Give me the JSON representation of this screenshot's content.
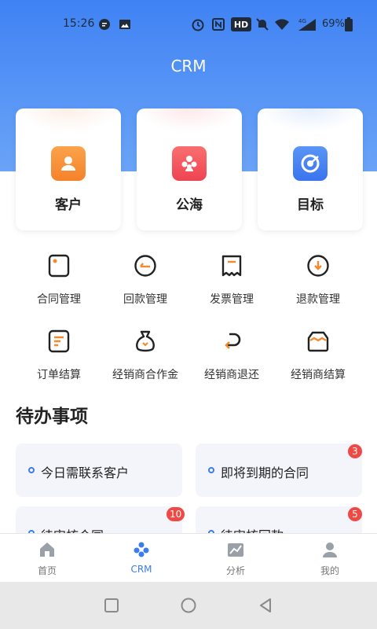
{
  "status_bar": {
    "time": "15:26",
    "network": "4G",
    "hd": "HD",
    "battery": "69%",
    "icons": [
      "chat-bubble-icon",
      "image-icon",
      "alarm-icon",
      "nfc-icon",
      "hd-icon",
      "mute-icon",
      "wifi-icon",
      "signal-icon",
      "battery-icon"
    ]
  },
  "header": {
    "title": "CRM"
  },
  "top_cards": [
    {
      "label": "客户",
      "icon": "person-icon",
      "color": "#f7892d"
    },
    {
      "label": "公海",
      "icon": "people-icon",
      "color": "#f2505a"
    },
    {
      "label": "目标",
      "icon": "target-icon",
      "color": "#3a7cf2"
    }
  ],
  "grid": [
    {
      "label": "合同管理",
      "icon": "contract-icon"
    },
    {
      "label": "回款管理",
      "icon": "payment-return-icon"
    },
    {
      "label": "发票管理",
      "icon": "invoice-icon"
    },
    {
      "label": "退款管理",
      "icon": "refund-icon"
    },
    {
      "label": "订单结算",
      "icon": "order-icon"
    },
    {
      "label": "经销商合作金",
      "icon": "money-bag-icon"
    },
    {
      "label": "经销商退还",
      "icon": "return-arrow-icon"
    },
    {
      "label": "经销商结算",
      "icon": "settlement-icon"
    }
  ],
  "todo_section": {
    "title": "待办事项",
    "items": [
      {
        "label": "今日需联系客户",
        "badge": ""
      },
      {
        "label": "即将到期的合同",
        "badge": "3"
      },
      {
        "label": "待审核合同",
        "badge": "10"
      },
      {
        "label": "待审核回款",
        "badge": "5"
      }
    ]
  },
  "tabbar": [
    {
      "label": "首页",
      "icon": "home-icon"
    },
    {
      "label": "CRM",
      "icon": "crm-icon"
    },
    {
      "label": "分析",
      "icon": "chart-icon"
    },
    {
      "label": "我的",
      "icon": "profile-icon"
    }
  ],
  "colors": {
    "primary": "#3a7cf2",
    "accent": "#f7892d",
    "badge": "#f04843"
  }
}
